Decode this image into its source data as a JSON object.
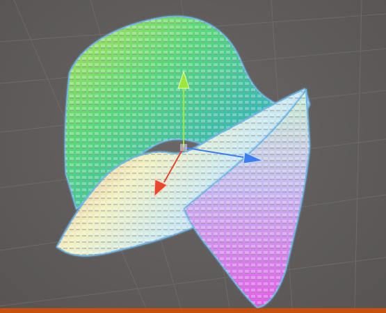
{
  "scene": {
    "background_color": "#5f5c5b",
    "grid_color": "#7a7776",
    "selection_outline_color": "#6fb6e6",
    "point_cloud_style": "colored-cubes",
    "gizmo": {
      "type": "move-tool",
      "x_axis_color": "#e8472b",
      "y_axis_color": "#9be83a",
      "z_axis_color": "#3d7df0"
    }
  },
  "status_strip": {
    "color": "#c8500e"
  }
}
